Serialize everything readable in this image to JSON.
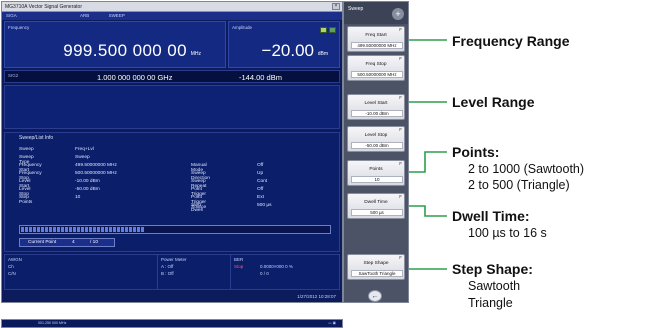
{
  "window": {
    "title": "MG3710A Vector Signal Generator",
    "close": "×"
  },
  "tabs": [
    "SIGA",
    "ARB",
    "SWEEP"
  ],
  "frequency": {
    "label": "Frequency",
    "value": "999.500 000 00",
    "unit": "MHz"
  },
  "amplitude": {
    "label": "Amplitude",
    "value": "−20.00",
    "unit": "dBm"
  },
  "readout": {
    "label": "SIG2",
    "freq": "1.000 000 000 00 GHz",
    "amp": "-144.00 dBm"
  },
  "sweep_info": {
    "title": "Sweep/List Info",
    "left": [
      {
        "k": "Sweep",
        "v": "Freq+Lvl"
      },
      {
        "k": "Sweep Type",
        "v": "Sweep"
      },
      {
        "k": "Frequency Start",
        "v": "499.50000000 MHz"
      },
      {
        "k": "Frequency Stop",
        "v": "500.50000000 MHz"
      },
      {
        "k": "Level Start",
        "v": "-10.00 dBm"
      },
      {
        "k": "Level Stop",
        "v": "-50.00 dBm"
      },
      {
        "k": "Step Points",
        "v": "10"
      }
    ],
    "right": [
      {
        "k": "Manual Mode",
        "v": "Off"
      },
      {
        "k": "Sweep Direction",
        "v": "Up"
      },
      {
        "k": "Sweep Repeat",
        "v": "Cont"
      },
      {
        "k": "Point Trigger",
        "v": "Off"
      },
      {
        "k": "Point Trigger Source",
        "v": "Ext"
      },
      {
        "k": "Step Dwell",
        "v": "500 µs"
      }
    ],
    "progress": 0.4,
    "current_point_label": "Current Point",
    "current_point": "4",
    "total_points": "/ 10"
  },
  "status": {
    "awgn_label": "AWGN",
    "awgn_lines": [
      "Ch",
      "C/N"
    ],
    "power_meter_label": "Power Meter",
    "power_meter_lines": [
      "A : Off",
      "B : Off"
    ],
    "ber_label": "BER",
    "ber_state": "Stop",
    "ber_line1": "0.0000×000    0 %",
    "ber_line2": "0    / 0"
  },
  "footer": {
    "date": "1/27/2012 10:28:07"
  },
  "menu": {
    "title": "Sweep",
    "icon": "+",
    "back": "←",
    "softkeys": [
      {
        "label": "Freq Start",
        "num": "F",
        "value": "499.50000000 MHz"
      },
      {
        "label": "Freq Stop",
        "num": "F",
        "value": "500.50000000 MHz"
      },
      {
        "label": "Level Start",
        "num": "F",
        "value": "-10.00 dBm"
      },
      {
        "label": "Level Stop",
        "num": "F",
        "value": "-50.00 dBm"
      },
      {
        "label": "Points",
        "num": "F",
        "value": "10"
      },
      {
        "label": "Dwell Time",
        "num": "F",
        "value": "500 µs"
      },
      {
        "label": "Step Shape",
        "num": "F",
        "value": "SawTooth Triangle"
      }
    ]
  },
  "annotations": {
    "freq_range": "Frequency Range",
    "level_range": "Level Range",
    "points": "Points:",
    "points_line1": "2 to 1000 (Sawtooth)",
    "points_line2": "2 to 500 (Triangle)",
    "dwell": "Dwell Time:",
    "dwell_line1": "100 µs to 16 s",
    "shape": "Step Shape:",
    "shape_line1": "Sawtooth",
    "shape_line2": "Triangle"
  },
  "thumbnail": {
    "text": "001.250 000 MHz",
    "icons": "▭ ▣"
  },
  "colors": {
    "screen_bg": "#0b1b5c",
    "callout_line": "#2e9e4a",
    "softkey_bg": "#e9eaef"
  }
}
